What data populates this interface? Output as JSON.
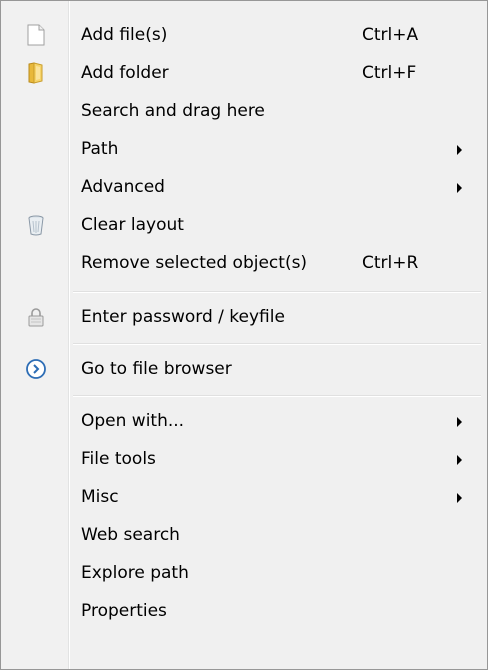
{
  "menu": {
    "items": [
      {
        "label": "Add file(s)",
        "shortcut": "Ctrl+A",
        "icon": "file-icon"
      },
      {
        "label": "Add folder",
        "shortcut": "Ctrl+F",
        "icon": "folder-icon"
      },
      {
        "label": "Search and drag here"
      },
      {
        "label": "Path",
        "submenu": true
      },
      {
        "label": "Advanced",
        "submenu": true
      },
      {
        "label": "Clear layout",
        "icon": "trash-icon"
      },
      {
        "label": "Remove selected object(s)",
        "shortcut": "Ctrl+R"
      },
      {
        "label": "Enter password / keyfile",
        "icon": "lock-icon"
      },
      {
        "label": "Go to file browser",
        "icon": "circle-arrow-right-icon"
      },
      {
        "label": "Open with...",
        "submenu": true
      },
      {
        "label": "File tools",
        "submenu": true
      },
      {
        "label": "Misc",
        "submenu": true
      },
      {
        "label": "Web search"
      },
      {
        "label": "Explore path"
      },
      {
        "label": "Properties"
      }
    ]
  }
}
